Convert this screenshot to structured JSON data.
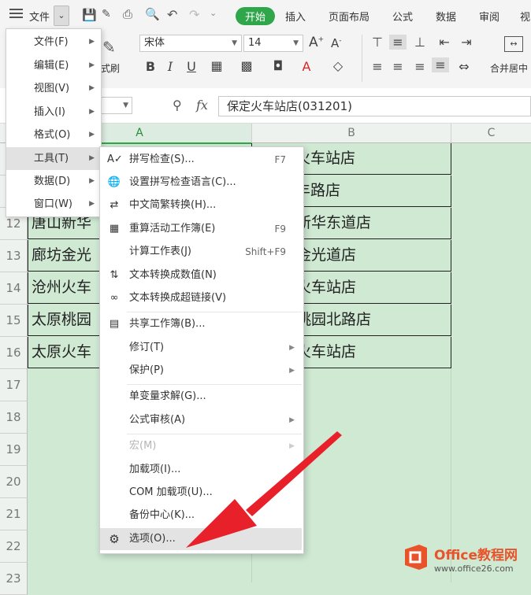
{
  "topbar": {
    "file_label": "文件",
    "tabs": [
      "开始",
      "插入",
      "页面布局",
      "公式",
      "数据",
      "审阅",
      "视"
    ]
  },
  "ribbon": {
    "font_name": "宋体",
    "font_size": "14",
    "format_brush_label": "格式刷",
    "merge_label": "合并居中"
  },
  "formula_bar": {
    "fx_label": "fx",
    "content": "保定火车站店(031201)"
  },
  "grid": {
    "columns": [
      "A",
      "B",
      "C"
    ],
    "rows": [
      "12",
      "13",
      "14",
      "15",
      "16",
      "17",
      "18",
      "19",
      "20",
      "21",
      "22",
      "23"
    ],
    "cells_a": [
      "唐山新华",
      "廊坊金光",
      "沧州火车",
      "太原桃园",
      "太原火车"
    ],
    "cells_b_top": [
      "火车站店",
      "丰路店"
    ],
    "cells_b": [
      "新华东道店",
      "金光道店",
      "火车站店",
      "桃园北路店",
      "火车站店"
    ]
  },
  "left_menu": [
    {
      "label": "文件(F)"
    },
    {
      "label": "编辑(E)"
    },
    {
      "label": "视图(V)"
    },
    {
      "label": "插入(I)"
    },
    {
      "label": "格式(O)"
    },
    {
      "label": "工具(T)"
    },
    {
      "label": "数据(D)"
    },
    {
      "label": "窗口(W)"
    }
  ],
  "submenu": [
    {
      "label": "拼写检查(S)...",
      "shortcut": "F7"
    },
    {
      "label": "设置拼写检查语言(C)...",
      "shortcut": ""
    },
    {
      "label": "中文简繁转换(H)...",
      "shortcut": ""
    },
    {
      "label": "重算活动工作簿(E)",
      "shortcut": "F9"
    },
    {
      "label": "计算工作表(J)",
      "shortcut": "Shift+F9"
    },
    {
      "label": "文本转换成数值(N)",
      "shortcut": ""
    },
    {
      "label": "文本转换成超链接(V)",
      "shortcut": ""
    },
    {
      "label": "共享工作簿(B)...",
      "shortcut": ""
    },
    {
      "label": "修订(T)",
      "shortcut": ""
    },
    {
      "label": "保护(P)",
      "shortcut": ""
    },
    {
      "label": "单变量求解(G)...",
      "shortcut": ""
    },
    {
      "label": "公式审核(A)",
      "shortcut": ""
    },
    {
      "label": "宏(M)",
      "shortcut": ""
    },
    {
      "label": "加载项(I)...",
      "shortcut": ""
    },
    {
      "label": "COM 加载项(U)...",
      "shortcut": ""
    },
    {
      "label": "备份中心(K)...",
      "shortcut": ""
    },
    {
      "label": "选项(O)...",
      "shortcut": ""
    }
  ],
  "watermark": {
    "brand": "Office教程网",
    "url": "www.office26.com"
  },
  "colors": {
    "accent": "#2fa64a",
    "arrow": "#e8202a",
    "sheet_bg": "#cfe9d3"
  }
}
